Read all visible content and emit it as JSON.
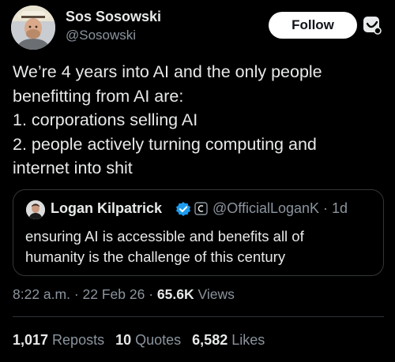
{
  "author": {
    "name": "Sos Sosowski",
    "handle": "@Sosowski",
    "avatar_icon": "user-avatar-photo"
  },
  "header": {
    "follow_label": "Follow",
    "grok_icon": "grok-icon"
  },
  "tweet": {
    "lines": [
      "We’re 4 years into AI and the only people",
      "benefitting from AI are:",
      "1. corporations selling AI",
      "2. people actively turning computing and",
      "internet into shit"
    ],
    "time": "8:22 a.m.",
    "sep1": " · ",
    "date": "22 Feb 26",
    "sep2": " · ",
    "views_count": "65.6K",
    "views_label": " Views"
  },
  "quote": {
    "name": "Logan Kilpatrick",
    "handle": "@OfficialLoganK",
    "sep": " · ",
    "age": "1d",
    "lines": [
      "ensuring AI is accessible and benefits all of",
      "humanity is the challenge of this century"
    ],
    "verified_color": "#1d9bf0"
  },
  "stats": {
    "reposts_count": "1,017",
    "reposts_label": " Reposts",
    "quotes_count": "10",
    "quotes_label": " Quotes",
    "likes_count": "6,582",
    "likes_label": " Likes"
  },
  "colors": {
    "background": "#000000",
    "primary_text": "#e7e9ea",
    "secondary_text": "#8b949e",
    "border": "#333639",
    "verified": "#1d9bf0"
  }
}
